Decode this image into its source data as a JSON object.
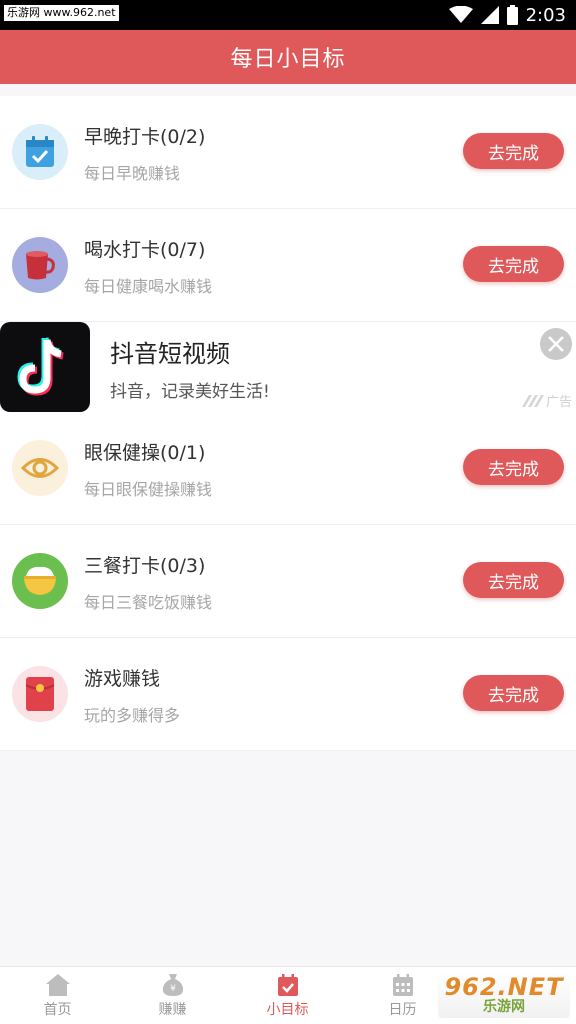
{
  "status_bar": {
    "watermark": "乐游网 www.962.net",
    "time": "2:03"
  },
  "header": {
    "title": "每日小目标"
  },
  "tasks": [
    {
      "title": "早晚打卡(0/2)",
      "subtitle": "每日早晚赚钱",
      "button": "去完成",
      "icon": "calendar-check-icon"
    },
    {
      "title": "喝水打卡(0/7)",
      "subtitle": "每日健康喝水赚钱",
      "button": "去完成",
      "icon": "mug-icon"
    },
    {
      "title": "眼保健操(0/1)",
      "subtitle": "每日眼保健操赚钱",
      "button": "去完成",
      "icon": "eye-icon"
    },
    {
      "title": "三餐打卡(0/3)",
      "subtitle": "每日三餐吃饭赚钱",
      "button": "去完成",
      "icon": "rice-bowl-icon"
    },
    {
      "title": "游戏赚钱",
      "subtitle": "玩的多赚得多",
      "button": "去完成",
      "icon": "red-envelope-icon"
    }
  ],
  "ad": {
    "title": "抖音短视频",
    "description": "抖音，记录美好生活!",
    "tag": "广告",
    "icon": "tiktok-logo-icon"
  },
  "tabs": [
    {
      "label": "首页",
      "icon": "home-icon",
      "active": false
    },
    {
      "label": "赚赚",
      "icon": "money-bag-icon",
      "active": false
    },
    {
      "label": "小目标",
      "icon": "calendar-check-icon",
      "active": true
    },
    {
      "label": "日历",
      "icon": "calendar-icon",
      "active": false
    }
  ],
  "watermark_br": {
    "top": "962.NET",
    "bottom": "乐游网"
  },
  "colors": {
    "accent": "#e0595a",
    "status_bar": "#000000",
    "card": "#ffffff",
    "page_bg": "#f7f7fa"
  }
}
